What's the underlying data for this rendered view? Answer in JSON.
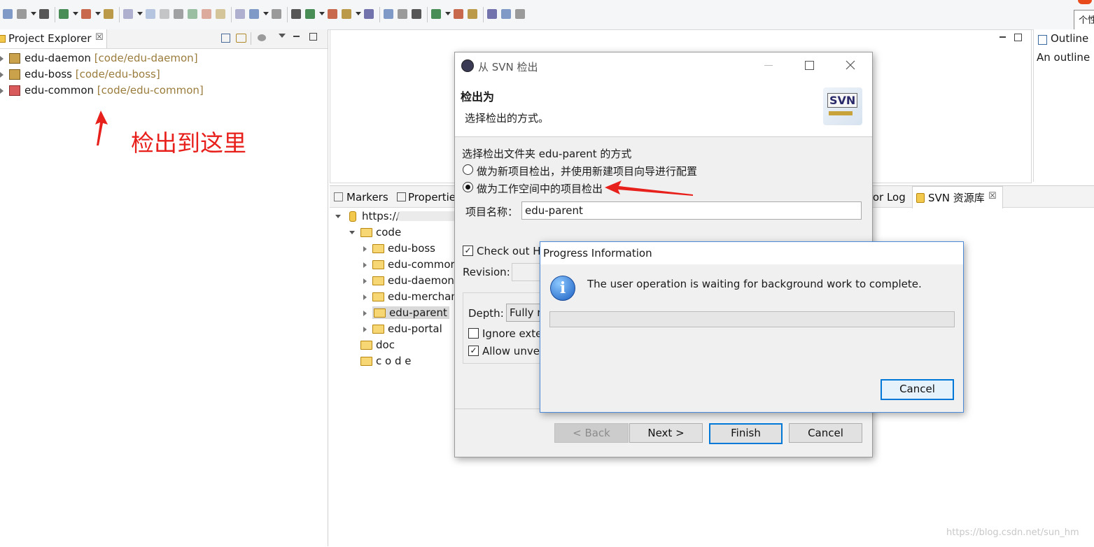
{
  "toolbar": {
    "icons": [
      "new-icon",
      "save-icon",
      "save-all-icon",
      "profile-icon",
      "console-icon",
      "pin-icon",
      "resume-icon",
      "suspend-icon",
      "terminate-icon",
      "disconnect-icon",
      "step-into-icon",
      "step-over-icon",
      "step-return-icon",
      "format-icon",
      "refactor-icon",
      "debug-icon",
      "run-icon",
      "coverage-icon",
      "external-tools-icon",
      "new-server-icon",
      "new-class-icon",
      "open-type-icon",
      "open-folder-icon",
      "search-icon",
      "globe-icon",
      "link-icon",
      "next-annotation-icon",
      "prev-annotation-icon",
      "back-icon",
      "forward-icon"
    ]
  },
  "corner_tooltip": "个性",
  "project_explorer": {
    "title": "Project Explorer",
    "close_glyph": "☒",
    "projects": [
      {
        "name": "edu-daemon",
        "path": "[code/edu-daemon]"
      },
      {
        "name": "edu-boss",
        "path": "[code/edu-boss]"
      },
      {
        "name": "edu-common",
        "path": "[code/edu-common]"
      }
    ],
    "annotation": "检出到这里"
  },
  "outline": {
    "title": "Outline",
    "text": "An outline i"
  },
  "bottom_tabs": {
    "markers": "Markers",
    "properties": "Propertie",
    "error_log": "ror Log",
    "svn_repo": "SVN 资源库"
  },
  "svn_tree": {
    "root": "https://",
    "code": "code",
    "children": [
      "edu-boss",
      "edu-commor",
      "edu-daemon",
      "edu-merchan",
      "edu-parent",
      "edu-portal"
    ],
    "doc": "doc",
    "code2": "c o d e"
  },
  "svn_dialog": {
    "title": "从 SVN 检出",
    "header_title": "检出为",
    "header_desc": "选择检出的方式。",
    "logo_text": "SVN",
    "method_label": "选择检出文件夹 edu-parent 的方式",
    "option1": "做为新项目检出，并使用新建项目向导进行配置",
    "option2": "做为工作空间中的项目检出",
    "project_name_label": "项目名称：",
    "project_name_value": "edu-parent",
    "checkout_head": "Check out H",
    "revision_label": "Revision:",
    "depth_label": "Depth:",
    "depth_value": "Fully re",
    "ignore_label": "Ignore exte",
    "allow_label": "Allow unver",
    "back_button": "< Back",
    "next_button": "Next >",
    "finish_button": "Finish",
    "cancel_button": "Cancel"
  },
  "progress_dialog": {
    "title": "Progress Information",
    "message": "The user operation is waiting for background work to complete.",
    "cancel_button": "Cancel"
  },
  "watermark": "https://blog.csdn.net/sun_hm",
  "colors": {
    "annotation_red": "#e8201c",
    "highlight_blue": "#0078d7",
    "path_brown": "#9a7c3c"
  }
}
